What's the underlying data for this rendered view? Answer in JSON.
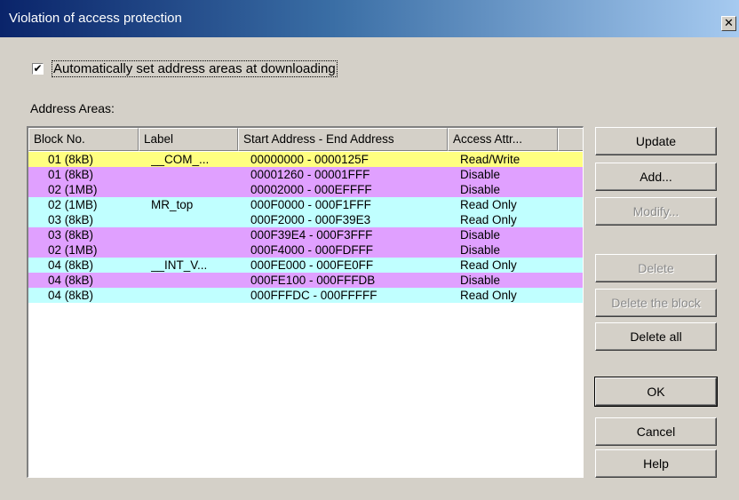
{
  "window": {
    "title": "Violation of access protection",
    "close_glyph": "✕"
  },
  "auto_set": {
    "checked": true,
    "check_glyph": "✔",
    "label": "Automatically set address areas at downloading"
  },
  "areas_label": "Address Areas:",
  "table": {
    "columns": [
      "Block No.",
      "Label",
      "Start Address - End Address",
      "Access Attr..."
    ],
    "rows": [
      {
        "block": "01 (8kB)",
        "label": "__COM_...",
        "range": "00000000 - 0000125F",
        "attr": "Read/Write",
        "color": "#ffff80"
      },
      {
        "block": "01 (8kB)",
        "label": "",
        "range": "00001260 - 00001FFF",
        "attr": "Disable",
        "color": "#e0a0ff"
      },
      {
        "block": "02 (1MB)",
        "label": "",
        "range": "00002000 - 000EFFFF",
        "attr": "Disable",
        "color": "#e0a0ff"
      },
      {
        "block": "02 (1MB)",
        "label": "MR_top",
        "range": "000F0000 - 000F1FFF",
        "attr": "Read Only",
        "color": "#c0ffff"
      },
      {
        "block": "03 (8kB)",
        "label": "",
        "range": "000F2000 - 000F39E3",
        "attr": "Read Only",
        "color": "#c0ffff"
      },
      {
        "block": "03 (8kB)",
        "label": "",
        "range": "000F39E4 - 000F3FFF",
        "attr": "Disable",
        "color": "#e0a0ff"
      },
      {
        "block": "02 (1MB)",
        "label": "",
        "range": "000F4000 - 000FDFFF",
        "attr": "Disable",
        "color": "#e0a0ff"
      },
      {
        "block": "04 (8kB)",
        "label": "__INT_V...",
        "range": "000FE000 - 000FE0FF",
        "attr": "Read Only",
        "color": "#c0ffff"
      },
      {
        "block": "04 (8kB)",
        "label": "",
        "range": "000FE100 - 000FFFDB",
        "attr": "Disable",
        "color": "#e0a0ff"
      },
      {
        "block": "04 (8kB)",
        "label": "",
        "range": "000FFFDC - 000FFFFF",
        "attr": "Read Only",
        "color": "#c0ffff"
      }
    ]
  },
  "buttons": {
    "update": "Update",
    "add": "Add...",
    "modify": "Modify...",
    "delete": "Delete",
    "delete_block": "Delete the block",
    "delete_all": "Delete all",
    "ok": "OK",
    "cancel": "Cancel",
    "help": "Help"
  }
}
